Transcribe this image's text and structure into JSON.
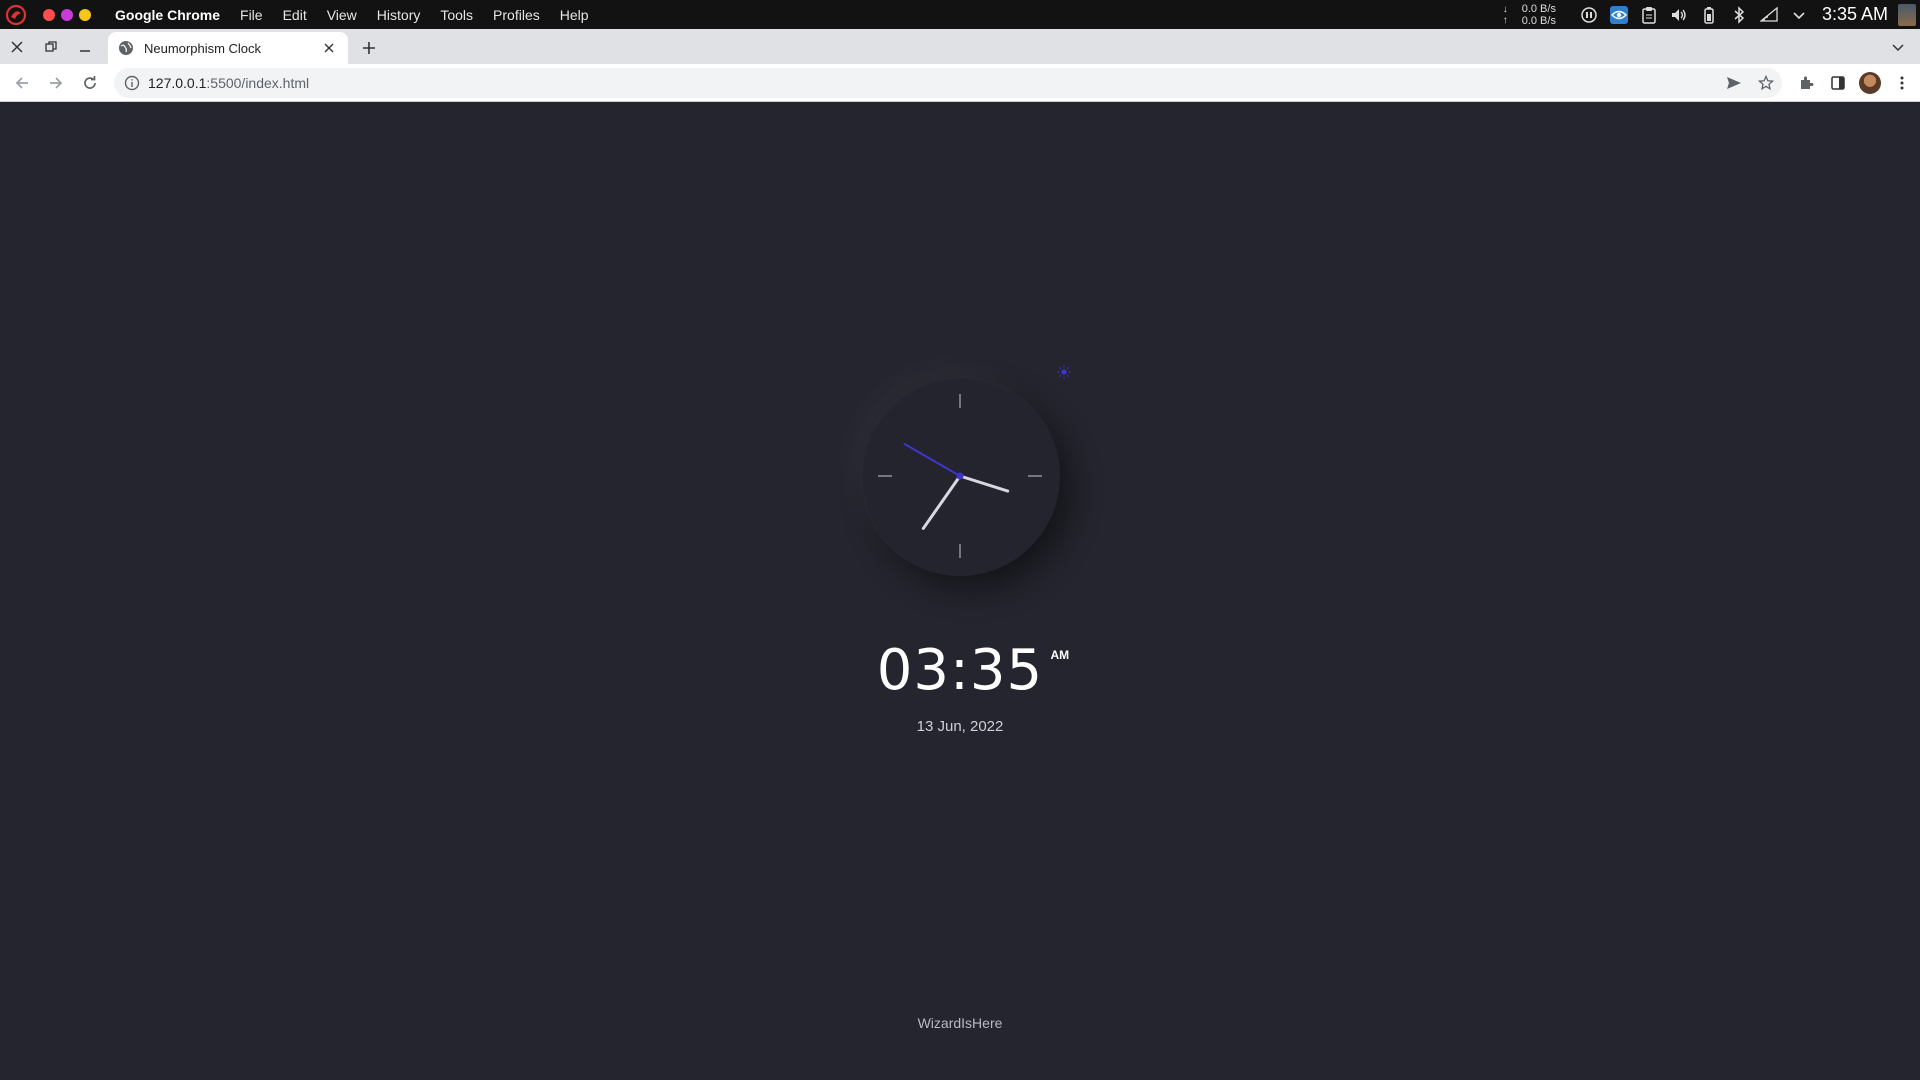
{
  "os": {
    "app_name": "Google Chrome",
    "menu": [
      "File",
      "Edit",
      "View",
      "History",
      "Tools",
      "Profiles",
      "Help"
    ],
    "net_down": "0.0 B/s",
    "net_up": "0.0 B/s",
    "net_down_arrow": "↓",
    "net_up_arrow": "↑",
    "clock": "3:35 AM",
    "traffic_colors": [
      "#ff4d4d",
      "#c83bd8",
      "#f5c518"
    ]
  },
  "browser": {
    "tab_title": "Neumorphism Clock",
    "url_host": "127.0.0.1",
    "url_rest": ":5500/index.html"
  },
  "page": {
    "time": "03:35",
    "ampm": "AM",
    "date": "13 Jun, 2022",
    "footer": "WizardIsHere",
    "accent": "#3f35c8",
    "analog": {
      "hour": 3,
      "minute": 35,
      "second": 50
    }
  }
}
